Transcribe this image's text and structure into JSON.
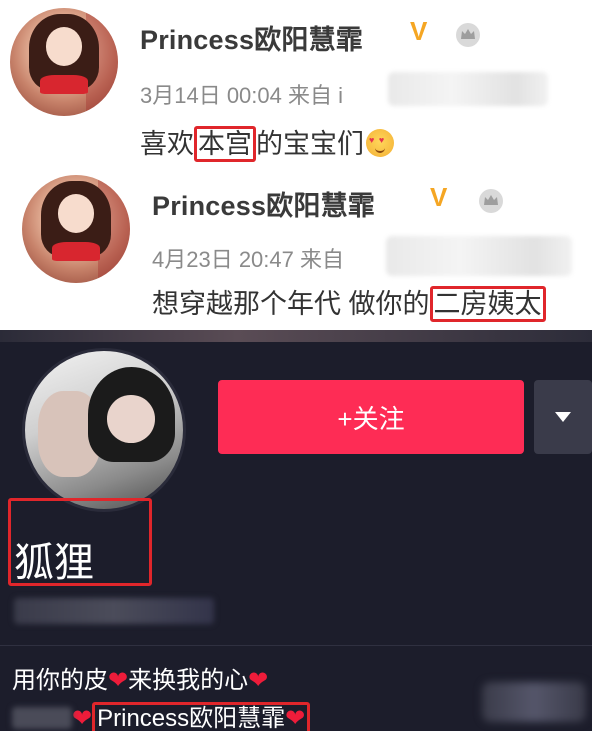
{
  "weibo": {
    "posts": [
      {
        "username": "Princess欧阳慧霏",
        "verified_badge": "V",
        "time": "3月14日 00:04",
        "source_label": "来自",
        "source_partial": "i",
        "text_before": "喜欢",
        "text_highlight": "本宫",
        "text_after": "的宝宝们",
        "emoji": "smiling-face-with-hearts"
      },
      {
        "username": "Princess欧阳慧霏",
        "verified_badge": "V",
        "time": "4月23日 20:47",
        "source_label": "来自",
        "text_before": "想穿越那个年代 做你的",
        "text_highlight": "二房姨太"
      }
    ]
  },
  "douyin": {
    "follow_label": "+关注",
    "nickname": "狐狸",
    "bio_line1_parts": [
      "用你的皮",
      "来换我的心"
    ],
    "bio_line2_highlight": "Princess欧阳慧霏",
    "heart_glyph": "❤",
    "colors": {
      "follow_bg": "#fe2c55",
      "page_bg": "#1c1d2b",
      "highlight_border": "#e0262b",
      "vip_badge": "#f5a623"
    }
  }
}
